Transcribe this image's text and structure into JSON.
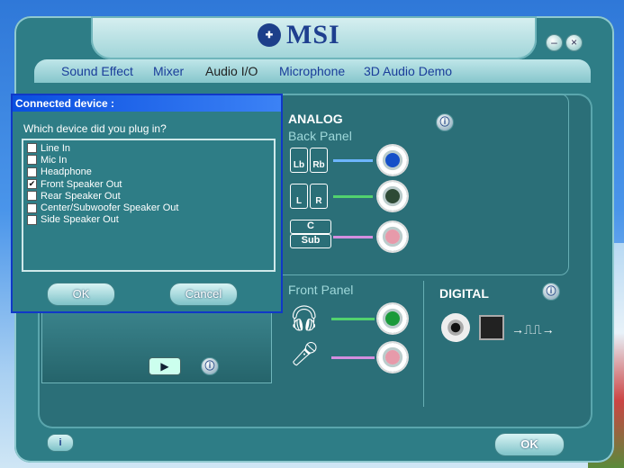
{
  "app": {
    "brand": "MSI",
    "tabs": [
      {
        "label": "Sound Effect",
        "active": false
      },
      {
        "label": "Mixer",
        "active": false
      },
      {
        "label": "Audio I/O",
        "active": true
      },
      {
        "label": "Microphone",
        "active": false
      },
      {
        "label": "3D Audio Demo",
        "active": false
      }
    ],
    "ok_label": "OK",
    "info_label": "i"
  },
  "analog": {
    "title": "ANALOG",
    "back_panel": "Back Panel",
    "front_panel": "Front Panel",
    "speaker_labels": [
      "Lb",
      "Rb",
      "L",
      "R",
      "C",
      "Sub"
    ],
    "jack_colors": {
      "back1": "#1550c8",
      "back2": "#2e4a36",
      "back3": "#e79aaa",
      "front1": "#1a9a3a",
      "front2": "#e79aaa"
    }
  },
  "digital": {
    "title": "DIGITAL"
  },
  "dialog": {
    "title": "Connected device :",
    "question": "Which device did you plug in?",
    "options": [
      {
        "label": "Line In",
        "checked": false
      },
      {
        "label": "Mic In",
        "checked": false
      },
      {
        "label": "Headphone",
        "checked": false
      },
      {
        "label": "Front Speaker Out",
        "checked": true
      },
      {
        "label": "Rear Speaker Out",
        "checked": false
      },
      {
        "label": "Center/Subwoofer Speaker Out",
        "checked": false
      },
      {
        "label": "Side Speaker Out",
        "checked": false
      }
    ],
    "ok_label": "OK",
    "cancel_label": "Cancel"
  }
}
